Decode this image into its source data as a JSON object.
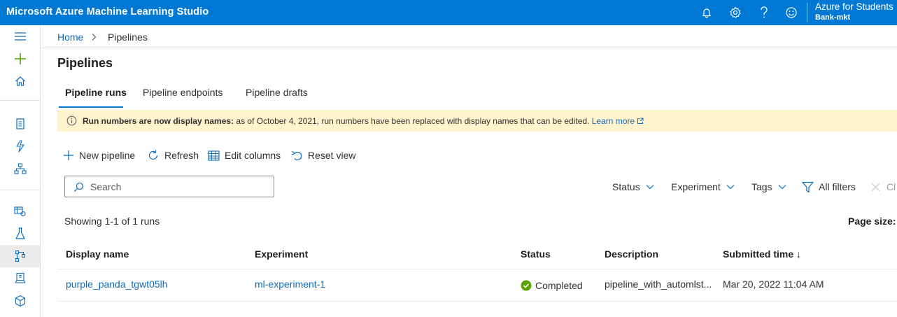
{
  "app": {
    "title": "Microsoft Azure Machine Learning Studio",
    "account_name": "Azure for Students",
    "workspace_name": "Bank-mkt",
    "top_icons": [
      "bell-icon",
      "gear-icon",
      "help-icon",
      "smiley-icon"
    ],
    "brand_color": "#0078d4"
  },
  "sidebar": {
    "items": [
      {
        "icon": "hamburger-icon"
      },
      {
        "icon": "plus-icon"
      },
      {
        "icon": "home-icon"
      },
      {
        "icon": "notebook-icon"
      },
      {
        "icon": "automl-icon"
      },
      {
        "icon": "designer-icon"
      },
      {
        "icon": "datasets-icon"
      },
      {
        "icon": "experiments-icon"
      },
      {
        "icon": "pipelines-icon",
        "active": true
      },
      {
        "icon": "models-icon"
      },
      {
        "icon": "endpoints-icon"
      }
    ]
  },
  "breadcrumb": {
    "home": "Home",
    "current": "Pipelines"
  },
  "page": {
    "title": "Pipelines"
  },
  "tabs": [
    {
      "label": "Pipeline runs",
      "active": true
    },
    {
      "label": "Pipeline endpoints",
      "active": false
    },
    {
      "label": "Pipeline drafts",
      "active": false
    }
  ],
  "banner": {
    "bold": "Run numbers are now display names:",
    "text": " as of October 4, 2021, run numbers have been replaced with display names that can be edited. ",
    "link": "Learn more",
    "color": "#fff4ce"
  },
  "toolbar": {
    "new_pipeline": "New pipeline",
    "refresh": "Refresh",
    "edit_columns": "Edit columns",
    "reset_view": "Reset view"
  },
  "search": {
    "placeholder": "Search"
  },
  "filters": {
    "status": "Status",
    "experiment": "Experiment",
    "tags": "Tags",
    "all_filters": "All filters",
    "clear": "Cl"
  },
  "list": {
    "showing": "Showing 1-1 of 1 runs",
    "page_size_label": "Page size:"
  },
  "table": {
    "columns": [
      "Display name",
      "Experiment",
      "Status",
      "Description",
      "Submitted time"
    ],
    "sort_indicator": "↓",
    "rows": [
      {
        "display_name": "purple_panda_tgwt05lh",
        "experiment": "ml-experiment-1",
        "status": "Completed",
        "description": "pipeline_with_automlst...",
        "submitted_time": "Mar 20, 2022 11:04 AM"
      }
    ],
    "status_color": "#57a300"
  }
}
